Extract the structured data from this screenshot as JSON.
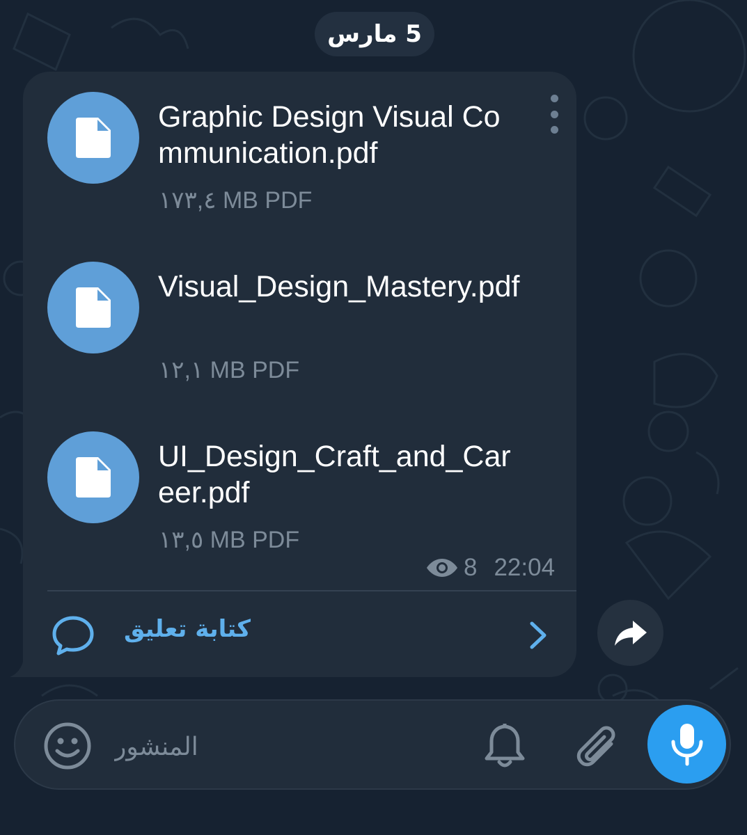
{
  "date_label": "5 مارس",
  "files": [
    {
      "name": "Graphic Design Visual Communication.pdf",
      "size": "١٧٣,٤ MB PDF",
      "icon": "document-icon"
    },
    {
      "name": "Visual_Design_Mastery.pdf",
      "size": "١٢,١ MB PDF",
      "icon": "document-icon"
    },
    {
      "name": "UI_Design_Craft_and_Career.pdf",
      "size": "١٣,٥ MB PDF",
      "icon": "document-icon"
    }
  ],
  "message": {
    "views": "8",
    "time": "22:04"
  },
  "comment": {
    "label": "كتابة تعليق"
  },
  "composer": {
    "placeholder": "المنشور"
  },
  "colors": {
    "background": "#162231",
    "bubble": "#212d3b",
    "accent": "#2b9ef0",
    "file_icon": "#5f9fd8",
    "link": "#5fb0ec",
    "meta": "#7d8b99"
  }
}
